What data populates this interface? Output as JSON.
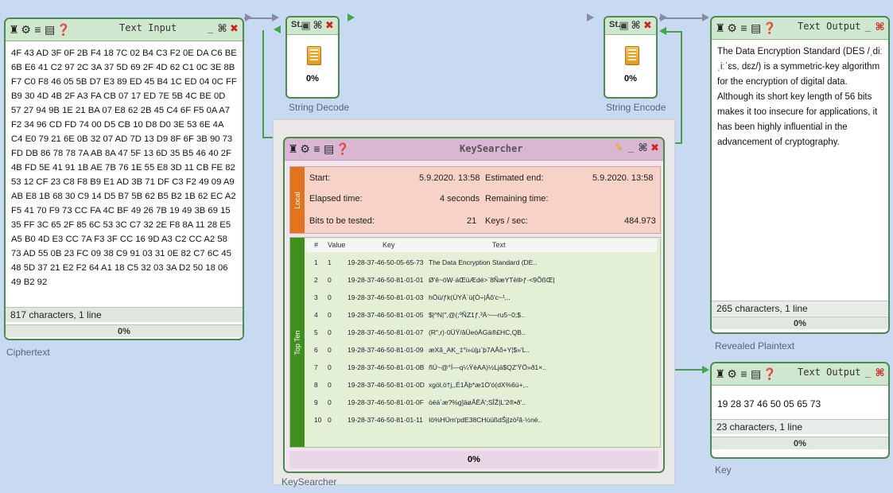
{
  "ciphertext_component": {
    "title": "Text Input",
    "text": "4F 43 AD 3F 0F 2B F4 18 7C 02 B4 C3 F2 0E DA C6 BE 6B E6 41 C2 97 2C 3A 37 5D 69 2F 4D 62 C1 0C 3E 8B F7 C0 F8 46 05 5B D7 E3 89 ED 45 B4 1C ED 04 0C FF B9 30 4D 4B 2F A3 FA CB 07 17 ED 7E 5B 4C BE 0D 57 27 94 9B 1E 21 BA 07 E8 62 2B 45 C4 6F F5 0A A7 F2 34 96 CD FD 74 00 D5 CB 10 D8 D0 3E 53 6E 4A C4 E0 79 21 6E 0B 32 07 AD 7D 13 D9 8F 6F 3B 90 73 FD DB 86 78 78 7A AB 8A 47 5F 13 6D 35 B5 46 40 2F 4B FD 5E 41 91 1B AE 7B 76 1E 55 E8 3D 11 CB FE 82 53 12 CF 23 C8 F8 B9 E1 AD 3B 71 DF C3 F2 49 09 A9 AB E8 1B 68 30 C9 14 D5 B7 5B 62 B5 B2 1B 62 EC A2 F5 41 70 F9 73 CC FA 4C BF 49 26 7B 19 49 3B 69 15 35 FF 3C 65 2F 85 6C 53 3C C7 32 2E F8 8A 11 28 E5 A5 B0 4D E3 CC 7A F3 3F CC 16 9D A3 C2 CC A2 58 73 AD 55 0B 23 FC 09 38 C9 91 03 31 0E 82 C7 6C 45 48 5D 37 21 E2 F2 64 A1 18 C5 32 03 3A D2 50 18 06 49 B2 92",
    "status": "817 characters,  1 line",
    "progress": "0%",
    "caption": "Ciphertext"
  },
  "string_decode": {
    "title": "St..",
    "progress": "0%",
    "caption": "String Decode"
  },
  "string_encode": {
    "title": "St..",
    "progress": "0%",
    "caption": "String Encode"
  },
  "plaintext_component": {
    "title": "Text Output",
    "text": "The Data Encryption Standard (DES /ˌdiːˌiːˈɛs, dɛz/) is a symmetric-key algorithm for the encryption of digital data. Although its short key length of 56 bits makes it too insecure for applications, it has been highly influential in the advancement of cryptography.",
    "status": "265 characters,  1 line",
    "progress": "0%",
    "caption": "Revealed Plaintext"
  },
  "key_component": {
    "title": "Text Output",
    "text": "19 28 37 46 50 05 65 73",
    "status": "23 characters,  1 line",
    "progress": "0%",
    "caption": "Key"
  },
  "keysearcher": {
    "title": "KeySearcher",
    "caption": "KeySearcher",
    "local_label": "Local",
    "topten_label": "Top Ten",
    "start_label": "Start:",
    "start_value": "5.9.2020. 13:58",
    "est_end_label": "Estimated end:",
    "est_end_value": "5.9.2020. 13:58",
    "elapsed_label": "Elapsed time:",
    "elapsed_value": "4 seconds",
    "remaining_label": "Remaining time:",
    "remaining_value": "",
    "bits_label": "Bits to be tested:",
    "bits_value": "21",
    "keys_label": "Keys / sec:",
    "keys_value": "484.973",
    "progress": "0%",
    "table_headers": {
      "num": "#",
      "value": "Value",
      "key": "Key",
      "text": "Text"
    },
    "rows": [
      {
        "num": "1",
        "value": "1",
        "key": "19-28-37-46-50-05-65-73",
        "text": "The Data Encryption Standard (DE.."
      },
      {
        "num": "2",
        "value": "0",
        "key": "19-28-37-46-50-81-01-01",
        "text": "Ø'ê~öW·äŒüÆdé>`8ÑæYTèlÞƒ·<9ÕßŒ|"
      },
      {
        "num": "3",
        "value": "0",
        "key": "19-28-37-46-50-81-01-03",
        "text": "hÖü/ƒk(ÙYÄ`ü{Ò÷|Âô'c~¹,.."
      },
      {
        "num": "4",
        "value": "0",
        "key": "19-28-37-46-50-81-01-05",
        "text": "$|^N|'',@(;ºÑZ1ƒ,³Ä~—ru5~0;$.."
      },
      {
        "num": "5",
        "value": "0",
        "key": "19-28-37-46-50-81-01-07",
        "text": "(R\",r)·0ÜŸ/âÜeóÄGä®£HC,QB.."
      },
      {
        "num": "6",
        "value": "0",
        "key": "19-28-37-46-50-81-01-09",
        "text": "æXã_AK_‡°i»ú|µ`þ7AÂõ+Y¦$»'L.."
      },
      {
        "num": "7",
        "value": "0",
        "key": "19-28-37-46-50-81-01-0B",
        "text": "ñÚ~@°Í—q¼ŸèAA)½Ljä$QZ'ŸÖ»ð1×.."
      },
      {
        "num": "8",
        "value": "0",
        "key": "19-28-37-46-50-81-01-0D",
        "text": "xgöl,ö†j,,É1Âþ*æ1Ò'ó(dX%6ü+,.."
      },
      {
        "num": "9",
        "value": "0",
        "key": "19-28-37-46-50-81-01-0F",
        "text": "òëä`æ?%g]äøÅÊÀ';SÎŽ|L'2®•ð'.."
      },
      {
        "num": "10",
        "value": "0",
        "key": "19-28-37-46-50-81-01-11",
        "text": "Iö%HÜm'pdE38CHùüßdŠj|zö²ã·½në.."
      }
    ]
  }
}
